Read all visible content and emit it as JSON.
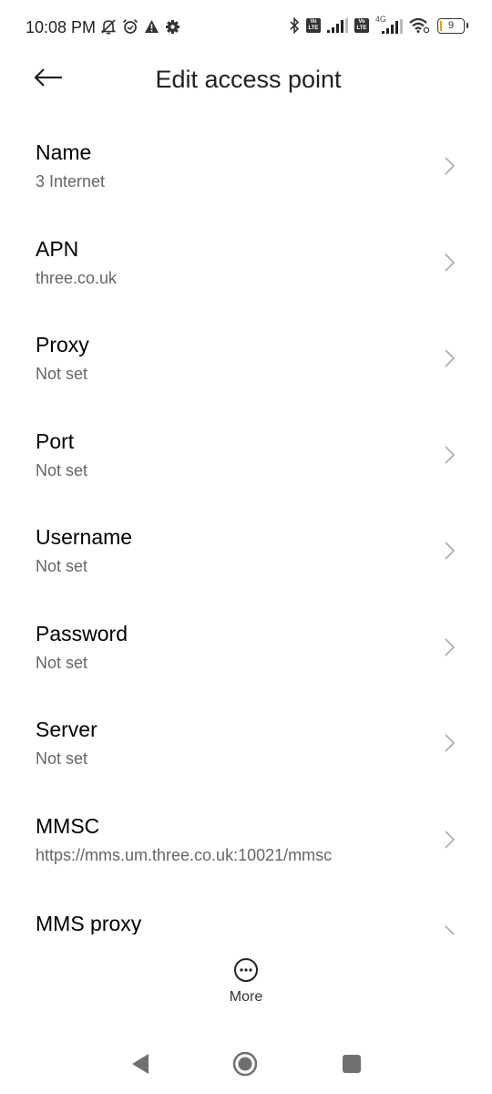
{
  "status_bar": {
    "time": "10:08 PM",
    "left_icons": [
      "notifications-muted-icon",
      "alarm-icon",
      "warning-icon",
      "settings-icon"
    ],
    "right_icons": [
      "bluetooth-icon",
      "volte-icon",
      "signal-icon",
      "volte-icon",
      "4g-signal-icon",
      "wifi-icon",
      "battery-icon"
    ],
    "volte_label_top": "Vo",
    "volte_label_bottom": "LTE",
    "network_type": "4G",
    "battery_level": "9"
  },
  "header": {
    "back_icon": "back-arrow-icon",
    "title": "Edit access point"
  },
  "settings": [
    {
      "label": "Name",
      "value": "3 Internet"
    },
    {
      "label": "APN",
      "value": "three.co.uk"
    },
    {
      "label": "Proxy",
      "value": "Not set"
    },
    {
      "label": "Port",
      "value": "Not set"
    },
    {
      "label": "Username",
      "value": "Not set"
    },
    {
      "label": "Password",
      "value": "Not set"
    },
    {
      "label": "Server",
      "value": "Not set"
    },
    {
      "label": "MMSC",
      "value": "https://mms.um.three.co.uk:10021/mmsc"
    },
    {
      "label": "MMS proxy",
      "value": ""
    }
  ],
  "bottom_bar": {
    "more_icon": "more-options-icon",
    "more_label": "More"
  },
  "nav_bar": {
    "back": "nav-back-icon",
    "home": "nav-home-icon",
    "recents": "nav-recents-icon"
  }
}
